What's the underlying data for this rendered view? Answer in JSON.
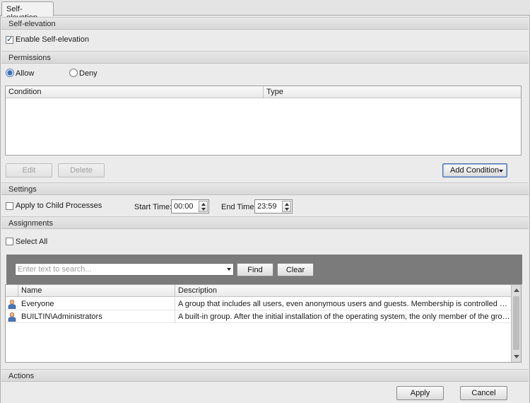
{
  "tab": {
    "label": "Self-elevation"
  },
  "self_elevation": {
    "header": "Self-elevation",
    "enable_label": "Enable Self-elevation",
    "enable_checked": true
  },
  "permissions": {
    "header": "Permissions",
    "allow_label": "Allow",
    "deny_label": "Deny",
    "selected": "Allow",
    "columns": [
      "Condition",
      "Type"
    ],
    "buttons": {
      "edit": "Edit",
      "delete": "Delete",
      "add_condition": "Add Condition"
    }
  },
  "settings": {
    "header": "Settings",
    "apply_child_label": "Apply to Child Processes",
    "start_time_label": "Start Time:",
    "start_time": "00:00",
    "end_time_label": "End Time:",
    "end_time": "23:59"
  },
  "assignments": {
    "header": "Assignments",
    "select_all_label": "Select All",
    "search_placeholder": "Enter text to search...",
    "find_label": "Find",
    "clear_label": "Clear",
    "columns": [
      "Name",
      "Description"
    ],
    "rows": [
      {
        "name": "Everyone",
        "description": "A group that includes all users, even anonymous users and guests. Membership is controlled by the operati..."
      },
      {
        "name": "BUILTIN\\Administrators",
        "description": "A built-in group. After the initial installation of the operating system, the only member of the group is the A..."
      }
    ]
  },
  "actions": {
    "header": "Actions",
    "apply_label": "Apply",
    "cancel_label": "Cancel"
  },
  "icons": {
    "user": "user-icon",
    "spin_up": "spin-up-icon",
    "spin_down": "spin-down-icon",
    "dropdown": "chevron-down-icon"
  }
}
